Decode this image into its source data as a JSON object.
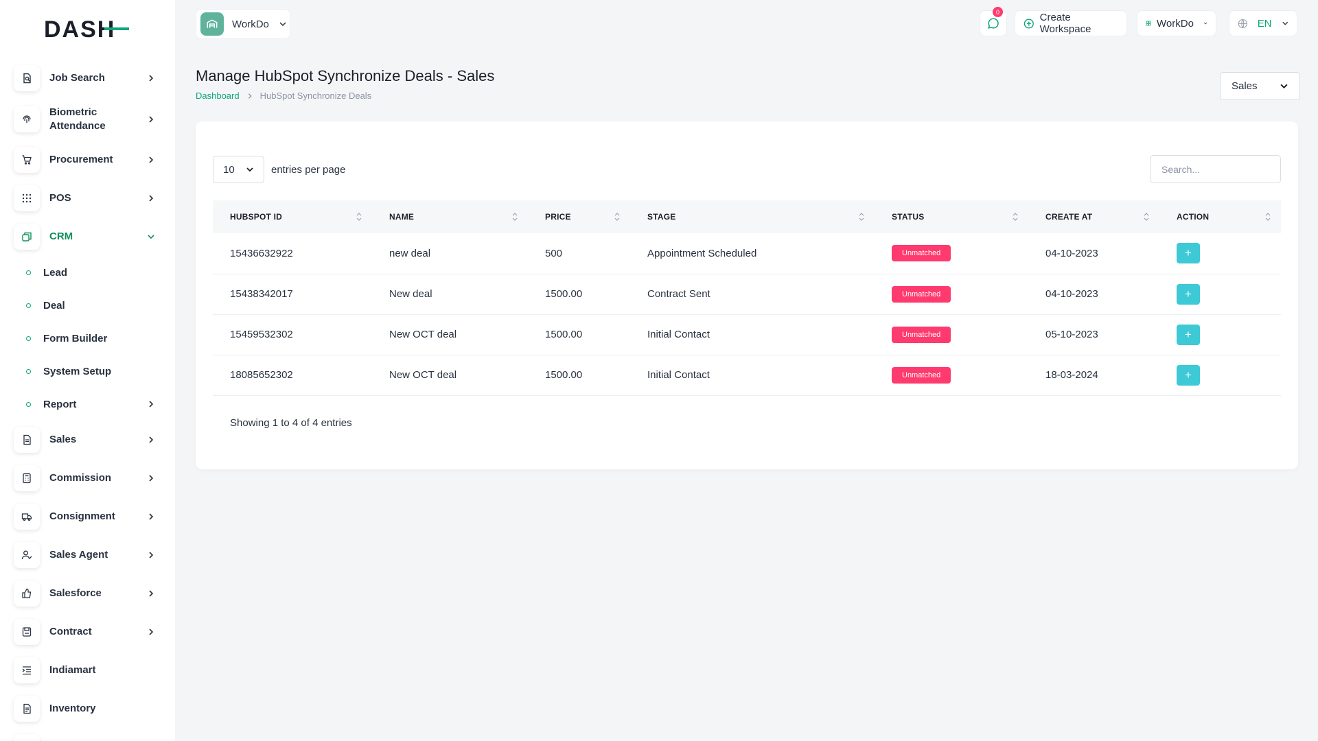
{
  "brand": {
    "logo_text": "DASH",
    "accent": "#0ca678",
    "danger": "#ff3a6e",
    "info": "#3ec9d6"
  },
  "topbar": {
    "workspace_name": "WorkDo",
    "notification_count": "0",
    "create_workspace_label": "Create Workspace",
    "workspace_menu_label": "WorkDo",
    "language_label": "EN"
  },
  "sidebar": {
    "items": [
      {
        "label": "Job Search",
        "icon": "job-search-icon"
      },
      {
        "label": "Biometric Attendance",
        "icon": "fingerprint-icon"
      },
      {
        "label": "Procurement",
        "icon": "cart-icon"
      },
      {
        "label": "POS",
        "icon": "grid-icon"
      },
      {
        "label": "CRM",
        "icon": "crm-icon"
      },
      {
        "label": "Sales",
        "icon": "document-icon"
      },
      {
        "label": "Commission",
        "icon": "calculator-icon"
      },
      {
        "label": "Consignment",
        "icon": "truck-icon"
      },
      {
        "label": "Sales Agent",
        "icon": "user-check-icon"
      },
      {
        "label": "Salesforce",
        "icon": "thumbs-up-icon"
      },
      {
        "label": "Contract",
        "icon": "contract-icon"
      },
      {
        "label": "Indiamart",
        "icon": "list-indent-icon"
      },
      {
        "label": "Inventory",
        "icon": "inventory-icon"
      }
    ],
    "crm_sub": [
      {
        "label": "Lead"
      },
      {
        "label": "Deal"
      },
      {
        "label": "Form Builder"
      },
      {
        "label": "System Setup"
      },
      {
        "label": "Report"
      }
    ]
  },
  "page": {
    "title": "Manage HubSpot Synchronize Deals - Sales",
    "breadcrumb_home": "Dashboard",
    "breadcrumb_current": "HubSpot Synchronize Deals",
    "pipeline_filter": "Sales"
  },
  "table": {
    "per_page": "10",
    "per_page_label": "entries per page",
    "search_placeholder": "Search...",
    "columns": [
      "HubSpot ID",
      "Name",
      "Price",
      "Stage",
      "Status",
      "Create At",
      "Action"
    ],
    "rows": [
      {
        "id": "15436632922",
        "name": "new deal",
        "price": "500",
        "stage": "Appointment Scheduled",
        "status": "Unmatched",
        "created": "04-10-2023"
      },
      {
        "id": "15438342017",
        "name": "New deal",
        "price": "1500.00",
        "stage": "Contract Sent",
        "status": "Unmatched",
        "created": "04-10-2023"
      },
      {
        "id": "15459532302",
        "name": "New OCT deal",
        "price": "1500.00",
        "stage": "Initial Contact",
        "status": "Unmatched",
        "created": "05-10-2023"
      },
      {
        "id": "18085652302",
        "name": "New OCT deal",
        "price": "1500.00",
        "stage": "Initial Contact",
        "status": "Unmatched",
        "created": "18-03-2024"
      }
    ],
    "action_label": "+",
    "footer": "Showing 1 to 4 of 4 entries"
  }
}
